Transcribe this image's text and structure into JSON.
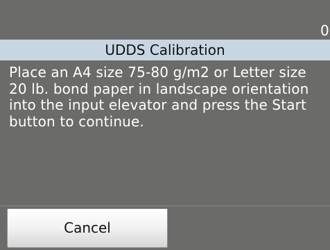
{
  "status": {
    "counter": "0"
  },
  "dialog": {
    "title": "UDDS Calibration",
    "message": "Place an A4 size 75-80 g/m2 or Letter size 20 lb. bond paper in landscape orientation into the input elevator and press the Start button to continue."
  },
  "actions": {
    "cancel_label": "Cancel"
  },
  "colors": {
    "background": "#6b6b6a",
    "title_bar": "#c8d6e3",
    "text": "#ffffff",
    "button_text": "#111111"
  }
}
